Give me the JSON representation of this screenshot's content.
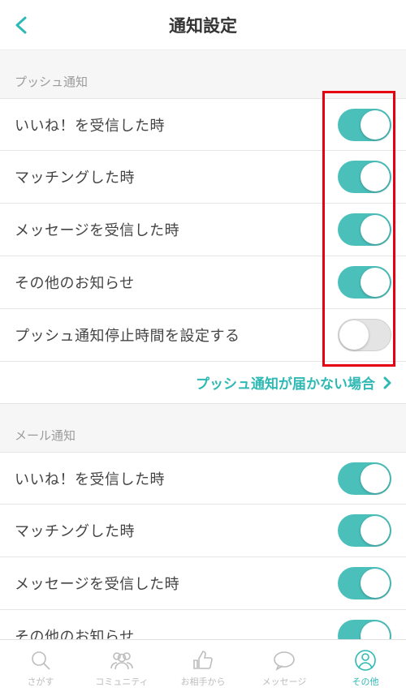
{
  "colors": {
    "accent": "#2fb9b4",
    "highlight": "#e60012"
  },
  "header": {
    "title": "通知設定"
  },
  "sections": [
    {
      "key": "push",
      "header": "プッシュ通知",
      "rows": [
        {
          "label": "いいね！を受信した時",
          "on": true
        },
        {
          "label": "マッチングした時",
          "on": true
        },
        {
          "label": "メッセージを受信した時",
          "on": true
        },
        {
          "label": "その他のお知らせ",
          "on": true
        },
        {
          "label": "プッシュ通知停止時間を設定する",
          "on": false
        }
      ],
      "highlighted": true,
      "link": {
        "label": "プッシュ通知が届かない場合"
      }
    },
    {
      "key": "mail",
      "header": "メール通知",
      "rows": [
        {
          "label": "いいね！を受信した時",
          "on": true
        },
        {
          "label": "マッチングした時",
          "on": true
        },
        {
          "label": "メッセージを受信した時",
          "on": true
        },
        {
          "label": "その他のお知らせ",
          "on": true
        }
      ]
    }
  ],
  "tabs": [
    {
      "label": "さがす",
      "icon": "search",
      "active": false
    },
    {
      "label": "コミュニティ",
      "icon": "community",
      "active": false
    },
    {
      "label": "お相手から",
      "icon": "like",
      "active": false
    },
    {
      "label": "メッセージ",
      "icon": "message",
      "active": false
    },
    {
      "label": "その他",
      "icon": "other",
      "active": true
    }
  ]
}
